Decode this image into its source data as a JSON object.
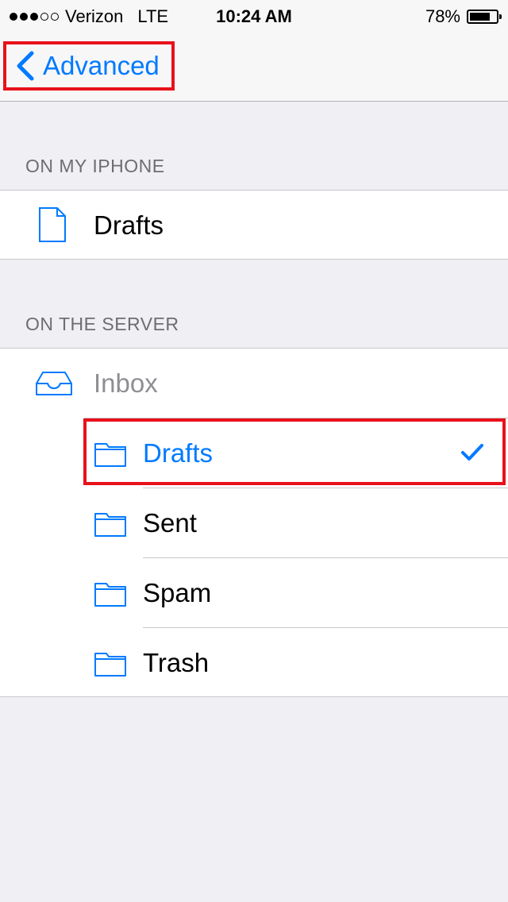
{
  "status_bar": {
    "carrier": "Verizon",
    "network": "LTE",
    "time": "10:24 AM",
    "battery": "78%",
    "battery_level": 0.78,
    "signal_strength": 3,
    "signal_max": 5
  },
  "nav": {
    "back_label": "Advanced"
  },
  "sections": {
    "local": {
      "header": "ON MY IPHONE",
      "items": [
        {
          "label": "Drafts",
          "icon": "document-icon"
        }
      ]
    },
    "server": {
      "header": "ON THE SERVER",
      "items": [
        {
          "label": "Inbox",
          "icon": "inbox-tray-icon",
          "enabled": false
        },
        {
          "label": "Drafts",
          "icon": "folder-icon",
          "selected": true
        },
        {
          "label": "Sent",
          "icon": "folder-icon"
        },
        {
          "label": "Spam",
          "icon": "folder-icon"
        },
        {
          "label": "Trash",
          "icon": "folder-icon"
        }
      ]
    }
  },
  "colors": {
    "accent": "#007aff",
    "highlight": "#e8111b",
    "background": "#efeff4",
    "disabled_text": "#8e8e93"
  }
}
